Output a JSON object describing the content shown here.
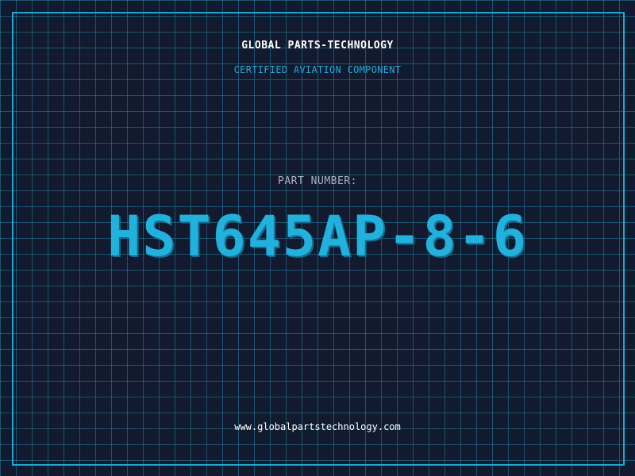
{
  "brand": {
    "name": "GLOBAL PARTS-TECHNOLOGY",
    "tagline": "CERTIFIED AVIATION COMPONENT"
  },
  "part": {
    "label": "PART NUMBER:",
    "number": "HST645AP-8-6"
  },
  "footer": {
    "url": "www.globalpartstechnology.com"
  },
  "colors": {
    "background": "#111a2e",
    "accent": "#22b0dc",
    "frame": "#1fa7cf",
    "grid": "#2882a0",
    "label": "#a9b2c3",
    "text": "#ffffff"
  }
}
